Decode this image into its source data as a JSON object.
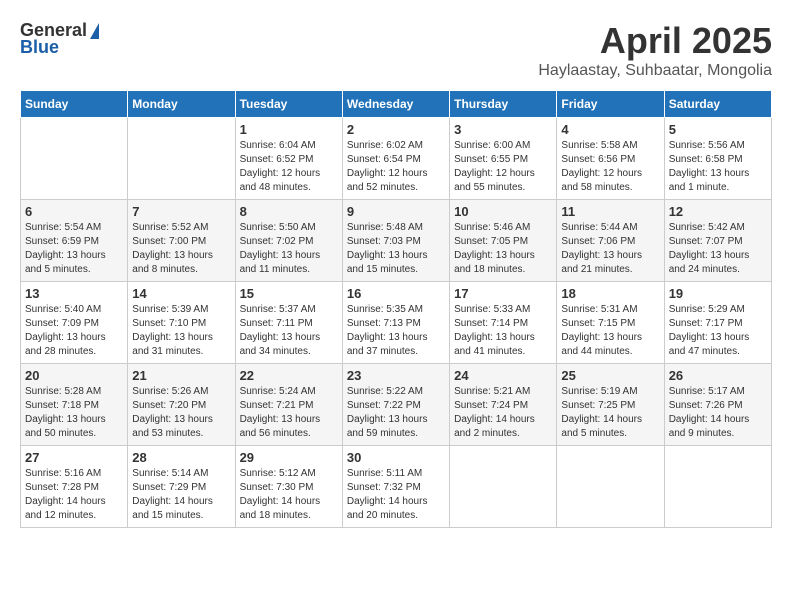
{
  "header": {
    "logo_general": "General",
    "logo_blue": "Blue",
    "month_title": "April 2025",
    "location": "Haylaastay, Suhbaatar, Mongolia"
  },
  "weekdays": [
    "Sunday",
    "Monday",
    "Tuesday",
    "Wednesday",
    "Thursday",
    "Friday",
    "Saturday"
  ],
  "weeks": [
    [
      {
        "day": "",
        "info": ""
      },
      {
        "day": "",
        "info": ""
      },
      {
        "day": "1",
        "info": "Sunrise: 6:04 AM\nSunset: 6:52 PM\nDaylight: 12 hours\nand 48 minutes."
      },
      {
        "day": "2",
        "info": "Sunrise: 6:02 AM\nSunset: 6:54 PM\nDaylight: 12 hours\nand 52 minutes."
      },
      {
        "day": "3",
        "info": "Sunrise: 6:00 AM\nSunset: 6:55 PM\nDaylight: 12 hours\nand 55 minutes."
      },
      {
        "day": "4",
        "info": "Sunrise: 5:58 AM\nSunset: 6:56 PM\nDaylight: 12 hours\nand 58 minutes."
      },
      {
        "day": "5",
        "info": "Sunrise: 5:56 AM\nSunset: 6:58 PM\nDaylight: 13 hours\nand 1 minute."
      }
    ],
    [
      {
        "day": "6",
        "info": "Sunrise: 5:54 AM\nSunset: 6:59 PM\nDaylight: 13 hours\nand 5 minutes."
      },
      {
        "day": "7",
        "info": "Sunrise: 5:52 AM\nSunset: 7:00 PM\nDaylight: 13 hours\nand 8 minutes."
      },
      {
        "day": "8",
        "info": "Sunrise: 5:50 AM\nSunset: 7:02 PM\nDaylight: 13 hours\nand 11 minutes."
      },
      {
        "day": "9",
        "info": "Sunrise: 5:48 AM\nSunset: 7:03 PM\nDaylight: 13 hours\nand 15 minutes."
      },
      {
        "day": "10",
        "info": "Sunrise: 5:46 AM\nSunset: 7:05 PM\nDaylight: 13 hours\nand 18 minutes."
      },
      {
        "day": "11",
        "info": "Sunrise: 5:44 AM\nSunset: 7:06 PM\nDaylight: 13 hours\nand 21 minutes."
      },
      {
        "day": "12",
        "info": "Sunrise: 5:42 AM\nSunset: 7:07 PM\nDaylight: 13 hours\nand 24 minutes."
      }
    ],
    [
      {
        "day": "13",
        "info": "Sunrise: 5:40 AM\nSunset: 7:09 PM\nDaylight: 13 hours\nand 28 minutes."
      },
      {
        "day": "14",
        "info": "Sunrise: 5:39 AM\nSunset: 7:10 PM\nDaylight: 13 hours\nand 31 minutes."
      },
      {
        "day": "15",
        "info": "Sunrise: 5:37 AM\nSunset: 7:11 PM\nDaylight: 13 hours\nand 34 minutes."
      },
      {
        "day": "16",
        "info": "Sunrise: 5:35 AM\nSunset: 7:13 PM\nDaylight: 13 hours\nand 37 minutes."
      },
      {
        "day": "17",
        "info": "Sunrise: 5:33 AM\nSunset: 7:14 PM\nDaylight: 13 hours\nand 41 minutes."
      },
      {
        "day": "18",
        "info": "Sunrise: 5:31 AM\nSunset: 7:15 PM\nDaylight: 13 hours\nand 44 minutes."
      },
      {
        "day": "19",
        "info": "Sunrise: 5:29 AM\nSunset: 7:17 PM\nDaylight: 13 hours\nand 47 minutes."
      }
    ],
    [
      {
        "day": "20",
        "info": "Sunrise: 5:28 AM\nSunset: 7:18 PM\nDaylight: 13 hours\nand 50 minutes."
      },
      {
        "day": "21",
        "info": "Sunrise: 5:26 AM\nSunset: 7:20 PM\nDaylight: 13 hours\nand 53 minutes."
      },
      {
        "day": "22",
        "info": "Sunrise: 5:24 AM\nSunset: 7:21 PM\nDaylight: 13 hours\nand 56 minutes."
      },
      {
        "day": "23",
        "info": "Sunrise: 5:22 AM\nSunset: 7:22 PM\nDaylight: 13 hours\nand 59 minutes."
      },
      {
        "day": "24",
        "info": "Sunrise: 5:21 AM\nSunset: 7:24 PM\nDaylight: 14 hours\nand 2 minutes."
      },
      {
        "day": "25",
        "info": "Sunrise: 5:19 AM\nSunset: 7:25 PM\nDaylight: 14 hours\nand 5 minutes."
      },
      {
        "day": "26",
        "info": "Sunrise: 5:17 AM\nSunset: 7:26 PM\nDaylight: 14 hours\nand 9 minutes."
      }
    ],
    [
      {
        "day": "27",
        "info": "Sunrise: 5:16 AM\nSunset: 7:28 PM\nDaylight: 14 hours\nand 12 minutes."
      },
      {
        "day": "28",
        "info": "Sunrise: 5:14 AM\nSunset: 7:29 PM\nDaylight: 14 hours\nand 15 minutes."
      },
      {
        "day": "29",
        "info": "Sunrise: 5:12 AM\nSunset: 7:30 PM\nDaylight: 14 hours\nand 18 minutes."
      },
      {
        "day": "30",
        "info": "Sunrise: 5:11 AM\nSunset: 7:32 PM\nDaylight: 14 hours\nand 20 minutes."
      },
      {
        "day": "",
        "info": ""
      },
      {
        "day": "",
        "info": ""
      },
      {
        "day": "",
        "info": ""
      }
    ]
  ]
}
